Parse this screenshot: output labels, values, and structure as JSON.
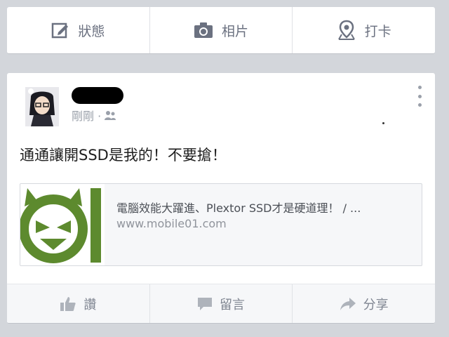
{
  "composer": {
    "status_label": "狀態",
    "photo_label": "相片",
    "checkin_label": "打卡"
  },
  "post": {
    "timestamp": "剛剛 · ",
    "privacy_icon": "friends-icon",
    "text": "通通讓開SSD是我的！不要搶！",
    "link": {
      "title": "電腦效能大躍進、Plextor SSD才是硬道理！ / ...",
      "url": "www.mobile01.com",
      "logo_color": "#5d8a2e"
    }
  },
  "actions": {
    "like_label": "讚",
    "comment_label": "留言",
    "share_label": "分享"
  }
}
